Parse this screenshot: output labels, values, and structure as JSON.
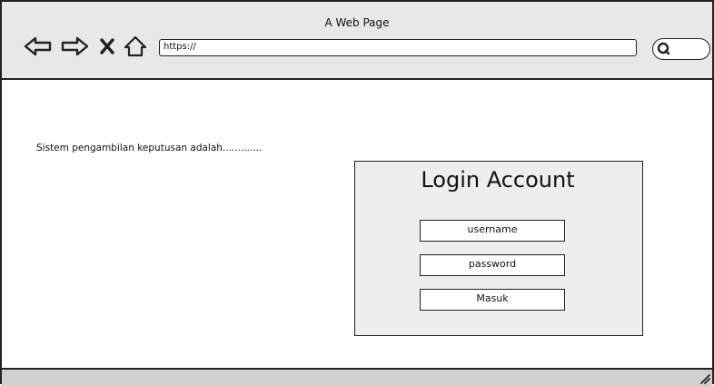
{
  "window": {
    "title": "A Web Page"
  },
  "toolbar": {
    "back_icon": "back-arrow-icon",
    "forward_icon": "forward-arrow-icon",
    "close_icon": "close-icon",
    "home_icon": "home-icon",
    "url": "https://",
    "search_icon": "search-icon"
  },
  "content": {
    "description": "Sistem pengambilan keputusan adalah.............",
    "login": {
      "title": "Login Account",
      "username_label": "username",
      "password_label": "password",
      "submit_label": "Masuk"
    }
  },
  "colors": {
    "chrome": "#e8e8e8",
    "panel": "#eeeeee",
    "stroke": "#222222"
  }
}
